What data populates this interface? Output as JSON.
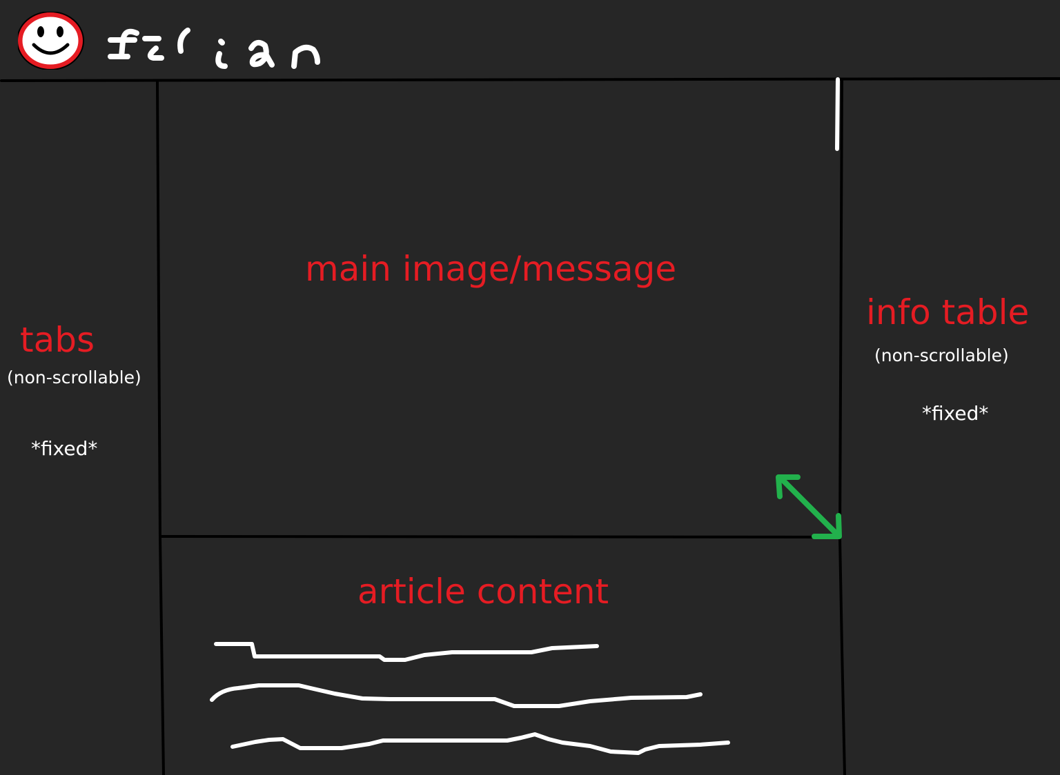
{
  "header": {
    "logo_icon": "smiley-face-icon",
    "brand_text": "filian",
    "colors": {
      "background": "#262626",
      "lines": "#000000",
      "logo_ring": "#e51c23",
      "labels_primary": "#e51c23",
      "labels_secondary": "#ffffff",
      "resize_arrow": "#22b14c"
    }
  },
  "left_panel": {
    "title": "tabs",
    "subtitle": "(non-scrollable)",
    "note": "*fixed*"
  },
  "main_panel": {
    "title": "main image/message",
    "resize_icon": "diagonal-resize-arrow-icon"
  },
  "article_panel": {
    "title": "article content",
    "placeholder_icon": "scribble-text-lines-icon"
  },
  "right_panel": {
    "title": "info table",
    "subtitle": "(non-scrollable)",
    "note": "*fixed*"
  }
}
